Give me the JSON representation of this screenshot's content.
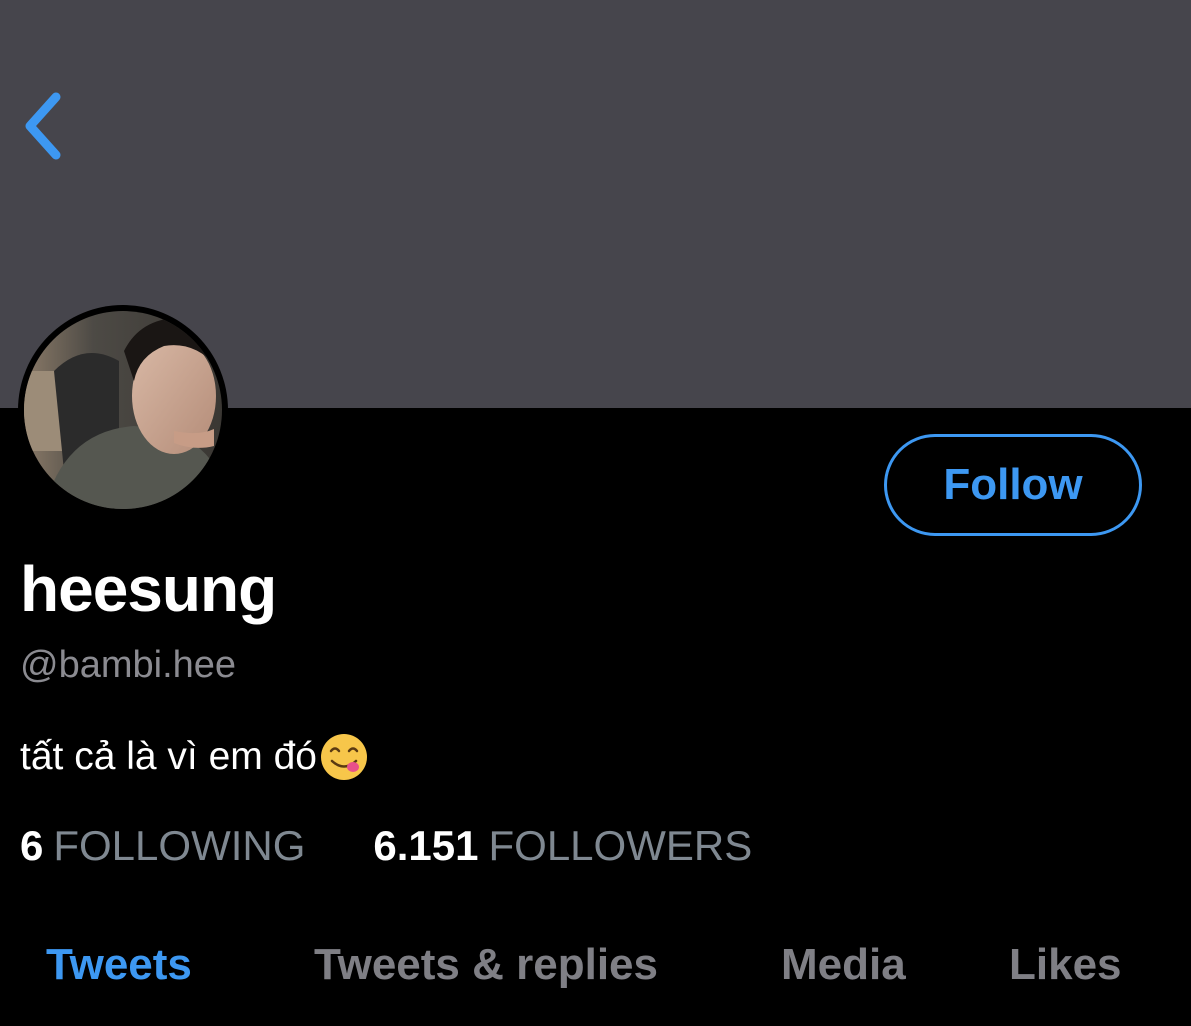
{
  "header": {
    "back_icon": "chevron-left-icon",
    "banner_color": "#46454c"
  },
  "profile": {
    "display_name": "heesung",
    "handle": "@bambi.hee",
    "bio": "tất cả là vì em đó",
    "bio_emoji": "face-savoring-food-emoji",
    "follow_label": "Follow",
    "accent_color": "#3d98f2"
  },
  "stats": {
    "following_count": "6",
    "following_label": "FOLLOWING",
    "followers_count": "6.151",
    "followers_label": "FOLLOWERS"
  },
  "tabs": [
    {
      "label": "Tweets",
      "active": true
    },
    {
      "label": "Tweets & replies",
      "active": false
    },
    {
      "label": "Media",
      "active": false
    },
    {
      "label": "Likes",
      "active": false
    }
  ]
}
